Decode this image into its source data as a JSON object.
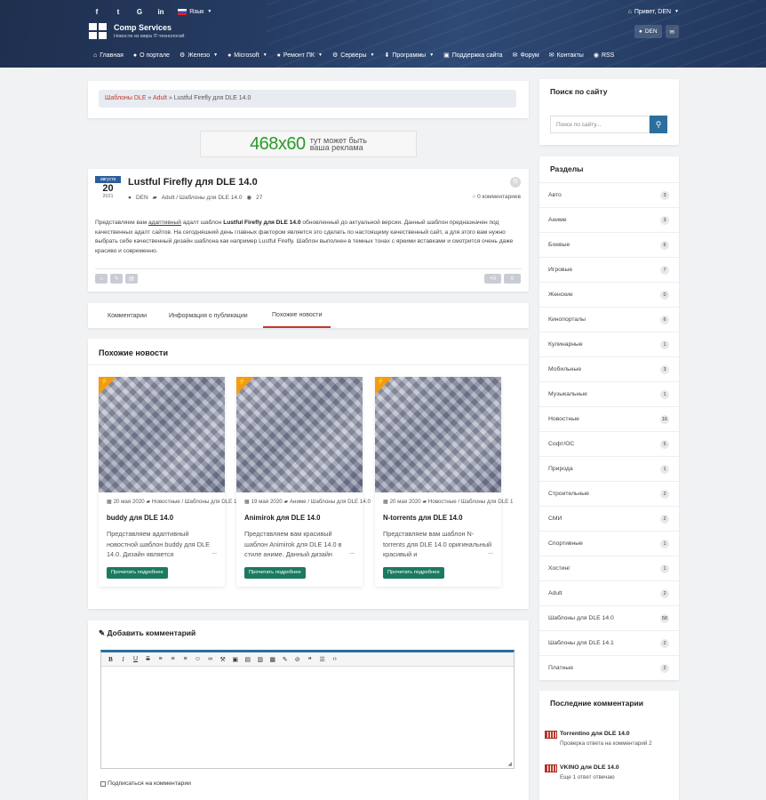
{
  "header": {
    "social": [
      "f",
      "t",
      "G",
      "in"
    ],
    "lang_label": "Язык",
    "greeting": "Привет, DEN",
    "user_button": "DEN",
    "logo_title": "Comp Services",
    "logo_subtitle": "Новости из мира IT-технологий"
  },
  "nav": [
    {
      "icon": "home-icon",
      "glyph": "⌂",
      "label": "Главная",
      "dropdown": false
    },
    {
      "icon": "info-icon",
      "glyph": "●",
      "label": "О портале",
      "dropdown": false
    },
    {
      "icon": "chip-icon",
      "glyph": "⚙",
      "label": "Железо",
      "dropdown": true
    },
    {
      "icon": "windows-icon",
      "glyph": "●",
      "label": "Microsoft",
      "dropdown": true
    },
    {
      "icon": "globe-icon",
      "glyph": "●",
      "label": "Ремонт ПК",
      "dropdown": true
    },
    {
      "icon": "server-icon",
      "glyph": "⚙",
      "label": "Серверы",
      "dropdown": true
    },
    {
      "icon": "download-icon",
      "glyph": "⬇",
      "label": "Программы",
      "dropdown": true
    },
    {
      "icon": "support-icon",
      "glyph": "▣",
      "label": "Поддержка сайта",
      "dropdown": false
    },
    {
      "icon": "forum-icon",
      "glyph": "✉",
      "label": "Форум",
      "dropdown": false
    },
    {
      "icon": "contacts-icon",
      "glyph": "✉",
      "label": "Контакты",
      "dropdown": false
    },
    {
      "icon": "rss-icon",
      "glyph": "◉",
      "label": "RSS",
      "dropdown": false
    }
  ],
  "breadcrumb": {
    "link1": "Шаблоны DLE",
    "link2": "Adult",
    "sep": "»",
    "current": "Lustful Firefly для DLE 14.0"
  },
  "banner": {
    "big": "468x60",
    "line1": "тут может быть",
    "line2": "ваша реклама"
  },
  "article": {
    "date_month": "августа",
    "date_day": "20",
    "date_year": "2021",
    "title": "Lustful Firefly для DLE 14.0",
    "author": "DEN",
    "category": "Adult / Шаблоны для DLE 14.0",
    "views": "27",
    "comments": "0 комментариев",
    "text_part1": "Представляем вам ",
    "text_link": "адаптивный",
    "text_part2": " адалт шаблон ",
    "text_bold": "Lustful Firefly для DLE 14.0",
    "text_part3": " обновленный до актуальной версии. Данный шаблон предназначен под качественных адалт сайтов. На сегодняшний день главных фактором является это сделать по настоящему качественный сайт, а для этого вам нужно выбрать себе качественный дизайн шаблона как например Lustful Firefly. Шаблон выполнен в темных тонах с яркими вставками и смотрится очень даже красиво и современно.",
    "rating_plus": "+0",
    "rating_minus": "0"
  },
  "tabs": [
    "Комментарии",
    "Информация о публикации",
    "Похожие новости"
  ],
  "similar": {
    "title": "Похожие новости",
    "cards": [
      {
        "date": "20 мая 2020",
        "category": "Новостные / Шаблоны для DLE 14.0",
        "title": "buddy для DLE 14.0",
        "text": "Представляем адаптивный новостной шаблон buddy для DLE 14.0. Дизайн является",
        "button": "Прочитать подробнее"
      },
      {
        "date": "19 мая 2020",
        "category": "Аниме / Шаблоны для DLE 14.0",
        "title": "Animirok для DLE 14.0",
        "text": "Представляем вам красивый шаблон Animirok для DLE 14.0 в стиле аниме. Данный дизайн",
        "button": "Прочитать подробнее"
      },
      {
        "date": "20 мая 2020",
        "category": "Новостные / Шаблоны для DLE 14.0",
        "title": "N-torrents для DLE 14.0",
        "text": "Представляем вам шаблон N-torrents для DLE 14.0 оригинальный красивый и",
        "button": "Прочитать подробнее"
      }
    ]
  },
  "add_comment": {
    "title": "Добавить комментарий",
    "subscribe": "Подписаться на комментарии"
  },
  "sidebar": {
    "search_title": "Поиск по сайту",
    "search_placeholder": "Поиск по сайту...",
    "cats_title": "Разделы",
    "categories": [
      {
        "name": "Авто",
        "count": "3"
      },
      {
        "name": "Аниме",
        "count": "3"
      },
      {
        "name": "Боевые",
        "count": "6"
      },
      {
        "name": "Игровые",
        "count": "7"
      },
      {
        "name": "Женские",
        "count": "0"
      },
      {
        "name": "Кинопорталы",
        "count": "6"
      },
      {
        "name": "Кулинарные",
        "count": "1"
      },
      {
        "name": "Мобильные",
        "count": "3"
      },
      {
        "name": "Музыкальные",
        "count": "1"
      },
      {
        "name": "Новостные",
        "count": "16"
      },
      {
        "name": "Софт/ОС",
        "count": "5"
      },
      {
        "name": "Природа",
        "count": "1"
      },
      {
        "name": "Строительные",
        "count": "2"
      },
      {
        "name": "СМИ",
        "count": "2"
      },
      {
        "name": "Спортивные",
        "count": "1"
      },
      {
        "name": "Хостинг",
        "count": "1"
      },
      {
        "name": "Adult",
        "count": "2"
      },
      {
        "name": "Шаблоны для DLE 14.0",
        "count": "58"
      },
      {
        "name": "Шаблоны для DLE 14.1",
        "count": "2"
      },
      {
        "name": "Платные",
        "count": "2"
      }
    ],
    "last_comments_title": "Последние комментарии",
    "last_comments": [
      {
        "title": "Torrentino для DLE 14.0",
        "text": "Проверка ответа на комментарий 2"
      },
      {
        "title": "VKINO для DLE 14.0",
        "text": "Еще 1 ответ отвечаю"
      }
    ]
  },
  "colors": {
    "accent": "#2c6e9e",
    "brand_dark": "#22375c",
    "button_green": "#1b7a5f",
    "link_red": "#c0392b"
  }
}
